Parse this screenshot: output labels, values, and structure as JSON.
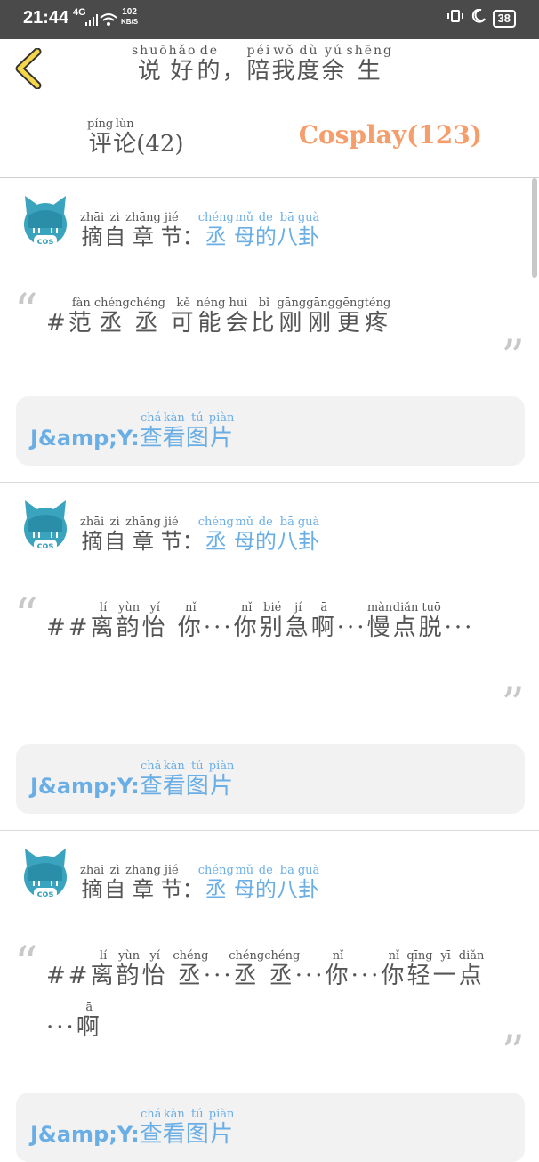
{
  "status_bar": {
    "time": "21:44",
    "network": "4G",
    "speed_value": "102",
    "speed_unit": "KB/S",
    "battery": "38"
  },
  "header": {
    "title": [
      {
        "c": "说",
        "p": "shuō"
      },
      {
        "c": "好",
        "p": "hǎo"
      },
      {
        "c": "的",
        "p": "de"
      },
      {
        "c": "，",
        "p": ""
      },
      {
        "c": "陪",
        "p": "péi"
      },
      {
        "c": "我",
        "p": "wǒ"
      },
      {
        "c": "度",
        "p": "dù"
      },
      {
        "c": "余",
        "p": "yú"
      },
      {
        "c": "生",
        "p": "shēng"
      }
    ]
  },
  "tabs": {
    "comment": [
      {
        "c": "评",
        "p": "píng"
      },
      {
        "c": "论",
        "p": "lùn"
      }
    ],
    "comment_count": "(42)",
    "cosplay": "Cosplay(123)"
  },
  "source_label": [
    {
      "c": "摘",
      "p": "zhāi"
    },
    {
      "c": "自",
      "p": "zì"
    },
    {
      "c": "章",
      "p": "zhāng"
    },
    {
      "c": "节",
      "p": "jié"
    },
    {
      "c": "：",
      "p": ""
    }
  ],
  "view_label": [
    {
      "c": "查",
      "p": "chá"
    },
    {
      "c": "看",
      "p": "kàn"
    },
    {
      "c": "图",
      "p": "tú"
    },
    {
      "c": "片",
      "p": "piàn"
    }
  ],
  "author": "J&amp;Y:",
  "avatar_text": "cos",
  "quote_open": "“",
  "quote_close": "”",
  "posts": [
    {
      "chapter": [
        {
          "c": "丞",
          "p": "chéng"
        },
        {
          "c": "母",
          "p": "mǔ"
        },
        {
          "c": "的",
          "p": "de"
        },
        {
          "c": "八",
          "p": "bā"
        },
        {
          "c": "卦",
          "p": "guà"
        }
      ],
      "content": [
        {
          "c": "#",
          "p": ""
        },
        {
          "c": "范",
          "p": "fàn"
        },
        {
          "c": "丞",
          "p": "chéng"
        },
        {
          "c": "丞",
          "p": "chéng"
        },
        {
          "c": " ",
          "p": ""
        },
        {
          "c": "可",
          "p": "kě"
        },
        {
          "c": "能",
          "p": "néng"
        },
        {
          "c": "会",
          "p": "huì"
        },
        {
          "c": "比",
          "p": "bǐ"
        },
        {
          "c": "刚",
          "p": "gāng"
        },
        {
          "c": "刚",
          "p": "gāng"
        },
        {
          "c": "更",
          "p": "gēng"
        },
        {
          "c": "疼",
          "p": "téng"
        }
      ]
    },
    {
      "chapter": [
        {
          "c": "丞",
          "p": "chéng"
        },
        {
          "c": "母",
          "p": "mǔ"
        },
        {
          "c": "的",
          "p": "de"
        },
        {
          "c": "八",
          "p": "bā"
        },
        {
          "c": "卦",
          "p": "guà"
        }
      ],
      "content": [
        {
          "c": "##",
          "p": ""
        },
        {
          "c": "离",
          "p": "lí"
        },
        {
          "c": "韵",
          "p": "yùn"
        },
        {
          "c": "怡",
          "p": "yí"
        },
        {
          "c": " ",
          "p": ""
        },
        {
          "c": "你",
          "p": "nǐ"
        },
        {
          "c": "···",
          "p": ""
        },
        {
          "c": "你",
          "p": "nǐ"
        },
        {
          "c": "别",
          "p": "bié"
        },
        {
          "c": "急",
          "p": "jí"
        },
        {
          "c": "啊",
          "p": "ā"
        },
        {
          "c": "···",
          "p": ""
        },
        {
          "c": "慢",
          "p": "màn"
        },
        {
          "c": "点",
          "p": "diǎn"
        },
        {
          "c": "脱",
          "p": "tuō"
        },
        {
          "c": "···",
          "p": ""
        }
      ]
    },
    {
      "chapter": [
        {
          "c": "丞",
          "p": "chéng"
        },
        {
          "c": "母",
          "p": "mǔ"
        },
        {
          "c": "的",
          "p": "de"
        },
        {
          "c": "八",
          "p": "bā"
        },
        {
          "c": "卦",
          "p": "guà"
        }
      ],
      "content": [
        {
          "c": "##",
          "p": ""
        },
        {
          "c": "离",
          "p": "lí"
        },
        {
          "c": "韵",
          "p": "yùn"
        },
        {
          "c": "怡",
          "p": "yí"
        },
        {
          "c": " ",
          "p": ""
        },
        {
          "c": "丞",
          "p": "chéng"
        },
        {
          "c": "···",
          "p": ""
        },
        {
          "c": "丞",
          "p": "chéng"
        },
        {
          "c": "丞",
          "p": "chéng"
        },
        {
          "c": "···",
          "p": ""
        },
        {
          "c": "你",
          "p": "nǐ"
        },
        {
          "c": "···",
          "p": ""
        },
        {
          "c": "你",
          "p": "nǐ"
        },
        {
          "c": "轻",
          "p": "qīng"
        },
        {
          "c": "一",
          "p": "yī"
        },
        {
          "c": "点",
          "p": "diǎn"
        },
        {
          "c": "···",
          "p": ""
        },
        {
          "c": "啊",
          "p": "ā"
        }
      ]
    }
  ],
  "colors": {
    "accent_blue": "#6aaee6",
    "cosplay_orange": "#f59e6c",
    "back_arrow_yellow": "#f5d64a"
  }
}
